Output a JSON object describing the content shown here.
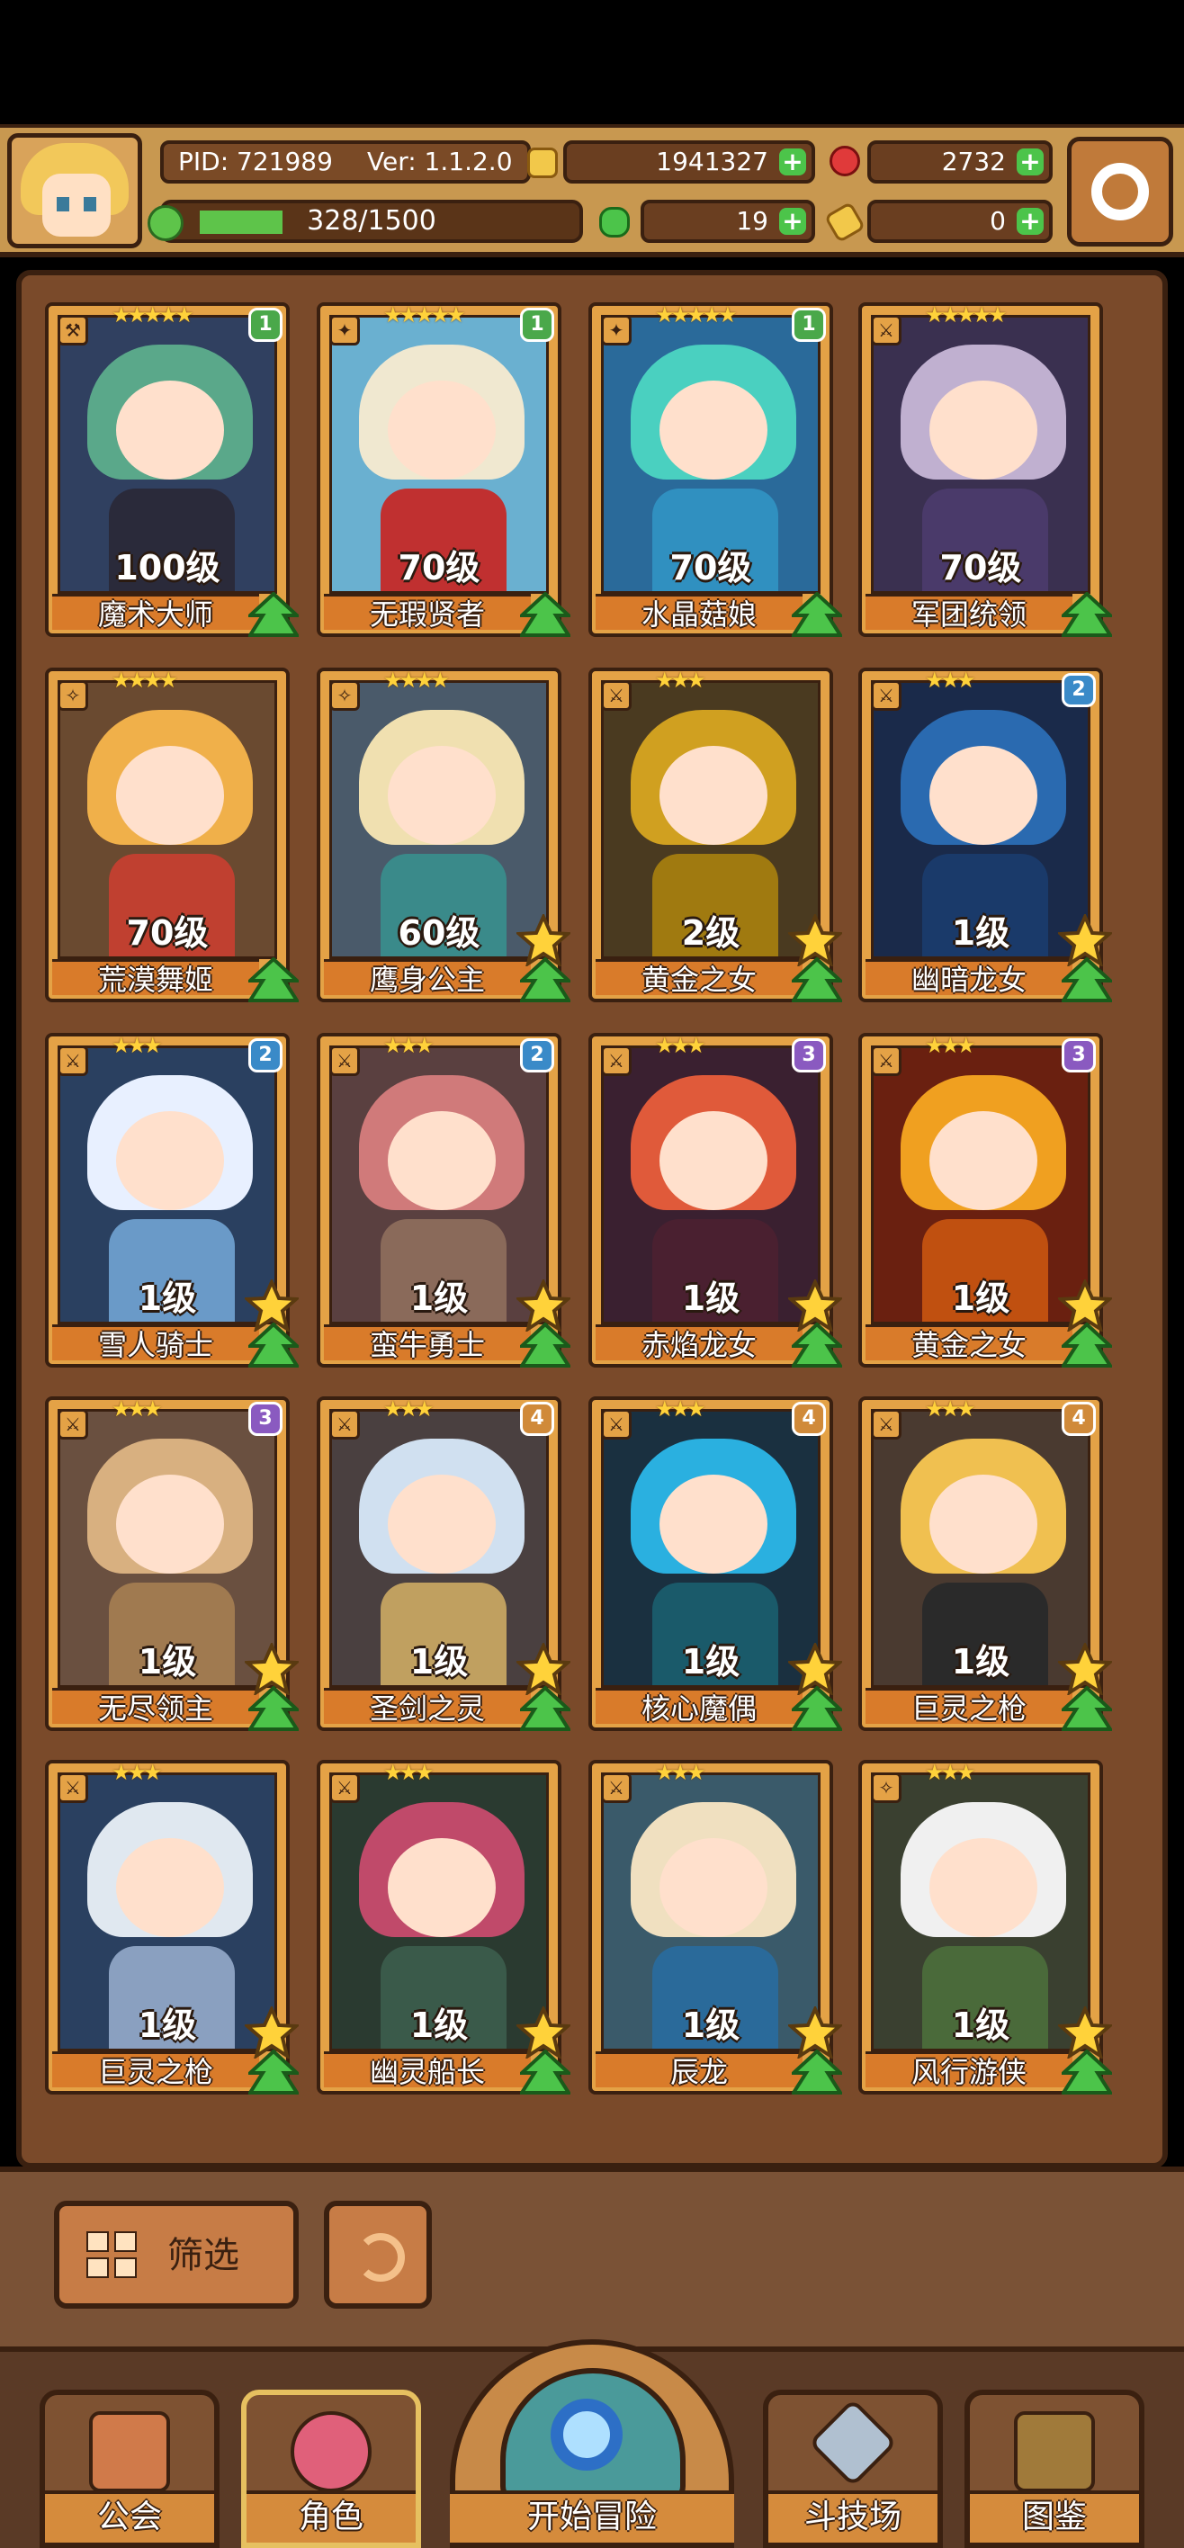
{
  "header": {
    "pid": "PID: 721989",
    "version": "Ver: 1.1.2.0",
    "gold": "1941327",
    "gems": "2732",
    "stamina": "328/1500",
    "stamina_fraction": 0.22,
    "clover": "19",
    "keys": "0"
  },
  "roster": [
    {
      "stars": "★★★★★",
      "badge": "1",
      "badge_color": "#4aa84a",
      "level": "100级",
      "name": "魔术大师",
      "hair": "#5aa88a",
      "body": "#2a2a3a",
      "bg": "#304060",
      "fav": false,
      "icon": "⚒"
    },
    {
      "stars": "★★★★★",
      "badge": "1",
      "badge_color": "#4aa84a",
      "level": "70级",
      "name": "无瑕贤者",
      "hair": "#f0e8d0",
      "body": "#c03030",
      "bg": "#6ab0d0",
      "fav": false,
      "icon": "✦"
    },
    {
      "stars": "★★★★★",
      "badge": "1",
      "badge_color": "#4aa84a",
      "level": "70级",
      "name": "水晶菇娘",
      "hair": "#4ad0c0",
      "body": "#3090c0",
      "bg": "#2a6a9a",
      "fav": false,
      "icon": "✦"
    },
    {
      "stars": "★★★★★",
      "badge": "",
      "badge_color": "",
      "level": "70级",
      "name": "军团统领",
      "hair": "#c0b0d0",
      "body": "#4a3a6a",
      "bg": "#3a3050",
      "fav": false,
      "icon": "⚔"
    },
    {
      "stars": "★★★★",
      "badge": "",
      "badge_color": "",
      "level": "70级",
      "name": "荒漠舞姬",
      "hair": "#f0b04a",
      "body": "#c04030",
      "bg": "#6a4a30",
      "fav": false,
      "icon": "✧"
    },
    {
      "stars": "★★★★",
      "badge": "",
      "badge_color": "",
      "level": "60级",
      "name": "鹰身公主",
      "hair": "#f0e0b0",
      "body": "#3a8a8a",
      "bg": "#4a5a6a",
      "fav": true,
      "icon": "✧"
    },
    {
      "stars": "★★★",
      "badge": "",
      "badge_color": "",
      "level": "2级",
      "name": "黄金之女",
      "hair": "#d0a020",
      "body": "#a07a10",
      "bg": "#4a3a20",
      "fav": true,
      "icon": "⚔"
    },
    {
      "stars": "★★★",
      "badge": "2",
      "badge_color": "#3a8ac8",
      "level": "1级",
      "name": "幽暗龙女",
      "hair": "#2a6ab0",
      "body": "#1a3a6a",
      "bg": "#1a2a4a",
      "fav": true,
      "icon": "⚔"
    },
    {
      "stars": "★★★",
      "badge": "2",
      "badge_color": "#3a8ac8",
      "level": "1级",
      "name": "雪人骑士",
      "hair": "#e8f0ff",
      "body": "#6a9ac8",
      "bg": "#2a4060",
      "fav": true,
      "icon": "⚔"
    },
    {
      "stars": "★★★",
      "badge": "2",
      "badge_color": "#3a8ac8",
      "level": "1级",
      "name": "蛮牛勇士",
      "hair": "#d07a7a",
      "body": "#8a6a5a",
      "bg": "#5a4040",
      "fav": true,
      "icon": "⚔"
    },
    {
      "stars": "★★★",
      "badge": "3",
      "badge_color": "#8a5ac0",
      "level": "1级",
      "name": "赤焰龙女",
      "hair": "#e05a3a",
      "body": "#4a2030",
      "bg": "#3a2030",
      "fav": true,
      "icon": "⚔"
    },
    {
      "stars": "★★★",
      "badge": "3",
      "badge_color": "#8a5ac0",
      "level": "1级",
      "name": "黄金之女",
      "hair": "#f0a020",
      "body": "#c05010",
      "bg": "#6a2010",
      "fav": true,
      "icon": "⚔"
    },
    {
      "stars": "★★★",
      "badge": "3",
      "badge_color": "#8a5ac0",
      "level": "1级",
      "name": "无尽领主",
      "hair": "#d8b080",
      "body": "#a07a50",
      "bg": "#6a5040",
      "fav": true,
      "icon": "⚔"
    },
    {
      "stars": "★★★",
      "badge": "4",
      "badge_color": "#d08a3a",
      "level": "1级",
      "name": "圣剑之灵",
      "hair": "#d0e0f0",
      "body": "#c0a060",
      "bg": "#4a4040",
      "fav": true,
      "icon": "⚔"
    },
    {
      "stars": "★★★",
      "badge": "4",
      "badge_color": "#d08a3a",
      "level": "1级",
      "name": "核心魔偶",
      "hair": "#2ab0e0",
      "body": "#1a5a6a",
      "bg": "#1a3040",
      "fav": true,
      "icon": "⚔"
    },
    {
      "stars": "★★★",
      "badge": "4",
      "badge_color": "#d08a3a",
      "level": "1级",
      "name": "巨灵之枪",
      "hair": "#f0c050",
      "body": "#2a2a2a",
      "bg": "#4a3a30",
      "fav": true,
      "icon": "⚔"
    },
    {
      "stars": "★★★",
      "badge": "",
      "badge_color": "",
      "level": "1级",
      "name": "巨灵之枪",
      "hair": "#e0e8f0",
      "body": "#8aa0c0",
      "bg": "#2a4060",
      "fav": true,
      "icon": "⚔"
    },
    {
      "stars": "★★★",
      "badge": "",
      "badge_color": "",
      "level": "1级",
      "name": "幽灵船长",
      "hair": "#c04a6a",
      "body": "#3a5a4a",
      "bg": "#2a3a30",
      "fav": true,
      "icon": "⚔"
    },
    {
      "stars": "★★★",
      "badge": "",
      "badge_color": "",
      "level": "1级",
      "name": "辰龙",
      "hair": "#f0e0c0",
      "body": "#2a6a9a",
      "bg": "#3a5a6a",
      "fav": true,
      "icon": "⚔"
    },
    {
      "stars": "★★★",
      "badge": "",
      "badge_color": "",
      "level": "1级",
      "name": "风行游侠",
      "hair": "#f0f0f0",
      "body": "#4a6a3a",
      "bg": "#3a4030",
      "fav": true,
      "icon": "✧"
    }
  ],
  "toolbar": {
    "filter_label": "筛选"
  },
  "nav": {
    "guild": "公会",
    "characters": "角色",
    "adventure": "开始冒险",
    "arena": "斗技场",
    "codex": "图鉴"
  }
}
